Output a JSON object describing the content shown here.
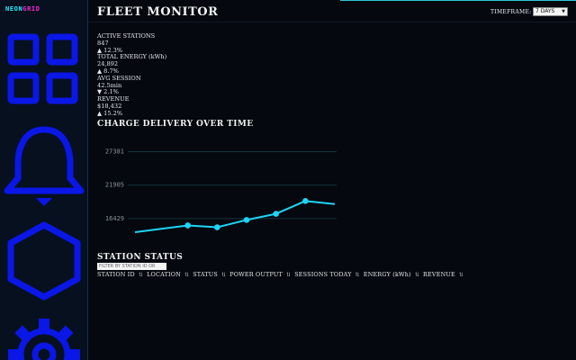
{
  "app": {
    "logo_part1": "NEON",
    "logo_part2": "GRID"
  },
  "sidebar": {
    "items": [
      {
        "label": "",
        "icon": "grid-icon"
      },
      {
        "label": "",
        "icon": "bell-icon"
      },
      {
        "label": "",
        "icon": "hexagon-icon"
      },
      {
        "label": "",
        "icon": "gear-icon"
      }
    ]
  },
  "header": {
    "title": "FLEET MONITOR",
    "timeframe_label": "TIMEFRAME:",
    "timeframe_value": "7 DAYS"
  },
  "stats": [
    {
      "label": "ACTIVE STATIONS",
      "value": "847",
      "change": "▲ 12.3%"
    },
    {
      "label": "TOTAL ENERGY (kWh)",
      "value": "24,892",
      "change": "▲ 8.7%"
    },
    {
      "label": "AVG SESSION",
      "value": "42.5min",
      "change": "▼ 2.1%"
    },
    {
      "label": "REVENUE",
      "value": "$18,432",
      "change": "▲ 15.2%"
    }
  ],
  "chart": {
    "title": "CHARGE DELIVERY OVER TIME"
  },
  "chart_data": {
    "type": "line",
    "title": "CHARGE DELIVERY OVER TIME",
    "xlabel": "",
    "ylabel": "",
    "y_ticks": [
      16429,
      21905,
      27381
    ],
    "ylim": [
      10953,
      30100
    ],
    "x": [
      1,
      2,
      3,
      4,
      5,
      6,
      7
    ],
    "values": [
      14200,
      15300,
      15000,
      16200,
      17200,
      19300,
      18800
    ],
    "marked_points": [
      1,
      2,
      3,
      4,
      5
    ],
    "grid": true,
    "legend": "none",
    "colors": {
      "line": "#1fd4f4",
      "grid": "#12343a",
      "tick": "#8a949e"
    }
  },
  "table": {
    "title": "STATION STATUS",
    "filter_placeholder": "FILTER BY STATION ID OR",
    "columns": [
      "STATION ID",
      "LOCATION",
      "STATUS",
      "POWER OUTPUT",
      "SESSIONS TODAY",
      "ENERGY (kWh)",
      "REVENUE"
    ],
    "sort_glyph": "⇅"
  },
  "colors": {
    "accent_cyan": "#22f3ff",
    "accent_magenta": "#ff2bd6",
    "icon_blue": "#0a17e6",
    "background": "#05080f"
  }
}
